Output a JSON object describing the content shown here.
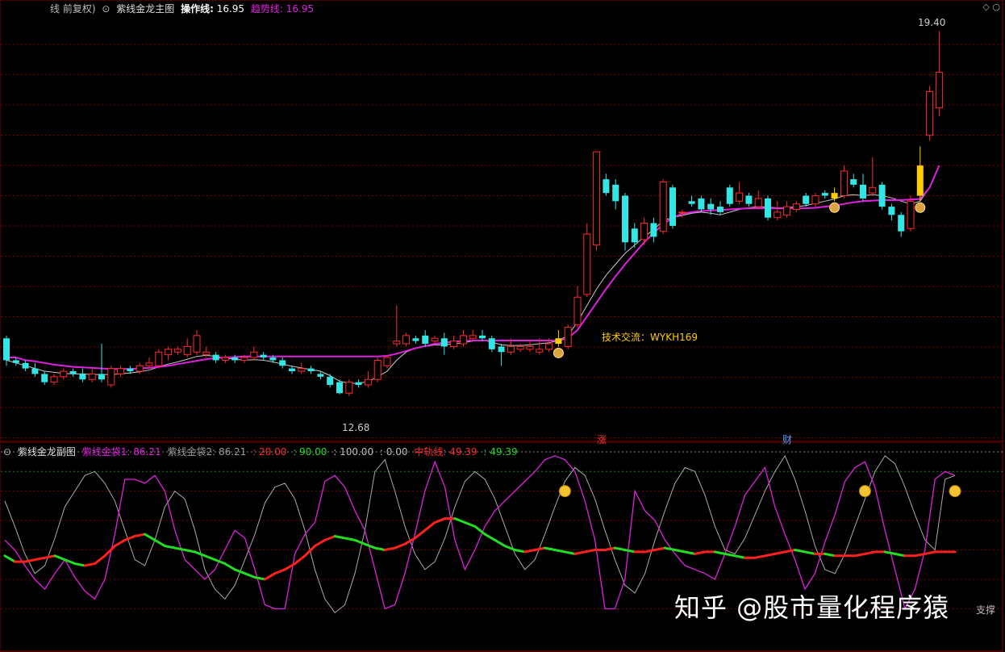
{
  "colors": {
    "bg": "#000000",
    "up": "#ff2a2a",
    "down": "#33e6e6",
    "signal": "#ffcc00",
    "trend": "#e020e0",
    "operate": "#c8c8c8",
    "grid": "#7a0000",
    "bullish_line": "#ff2020",
    "bearish_line": "#22dd22",
    "gold_bag1": "#e020e0",
    "gold_bag2": "#aaaaaa"
  },
  "header_main": {
    "mode_text": "线 前复权)",
    "chart_name": "紫线金龙主图",
    "operate_label": "操作线:",
    "operate_value": "16.95",
    "trend_label": "趋势线:",
    "trend_value": "16.95"
  },
  "header_ind": {
    "name": "紫线金龙副图",
    "bag1_label": "紫线金袋1:",
    "bag1_value": "86.21",
    "bag2_label": "紫线金袋2:",
    "bag2_value": "86.21",
    "level1": ": 20.00",
    "level2": ": 90.00",
    "level3": ": 100.00",
    "level4": ": 0.00",
    "mid_label": "中轨线:",
    "mid_value": "49.39",
    "mid_value2": ": 49.39"
  },
  "annotations": {
    "high_label": "19.40",
    "low_label": "12.68",
    "tech_note": "技术交流：WYKH169",
    "event_zhang": "涨",
    "event_cai": "财",
    "side_text": "支撑"
  },
  "watermark": "知乎 @股市量化程序猿",
  "chart_data": [
    {
      "type": "candlestick",
      "title": "紫线金龙主图",
      "ylim": [
        12.2,
        19.6
      ],
      "candles": [
        [
          13.8,
          13.4,
          13.85,
          13.3
        ],
        [
          13.4,
          13.35,
          13.45,
          13.3
        ],
        [
          13.35,
          13.25,
          13.4,
          13.2
        ],
        [
          13.25,
          13.15,
          13.35,
          13.1
        ],
        [
          13.15,
          13.0,
          13.2,
          12.95
        ],
        [
          13.0,
          13.1,
          13.15,
          12.95
        ],
        [
          13.1,
          13.2,
          13.25,
          13.05
        ],
        [
          13.2,
          13.15,
          13.25,
          13.1
        ],
        [
          13.15,
          13.05,
          13.25,
          13.0
        ],
        [
          13.05,
          13.15,
          13.25,
          13.0
        ],
        [
          13.15,
          13.05,
          13.7,
          13.0
        ],
        [
          12.95,
          13.25,
          13.3,
          12.9
        ],
        [
          13.15,
          13.25,
          13.3,
          13.1
        ],
        [
          13.25,
          13.2,
          13.3,
          13.15
        ],
        [
          13.2,
          13.3,
          13.35,
          13.15
        ],
        [
          13.3,
          13.35,
          13.45,
          13.25
        ],
        [
          13.3,
          13.55,
          13.6,
          13.25
        ],
        [
          13.5,
          13.6,
          13.65,
          13.4
        ],
        [
          13.55,
          13.6,
          13.65,
          13.5
        ],
        [
          13.5,
          13.65,
          13.8,
          13.45
        ],
        [
          13.55,
          13.85,
          13.95,
          13.5
        ],
        [
          13.5,
          13.55,
          13.65,
          13.45
        ],
        [
          13.5,
          13.4,
          13.55,
          13.35
        ],
        [
          13.4,
          13.45,
          13.5,
          13.35
        ],
        [
          13.45,
          13.4,
          13.5,
          13.35
        ],
        [
          13.4,
          13.45,
          13.5,
          13.35
        ],
        [
          13.45,
          13.55,
          13.65,
          13.4
        ],
        [
          13.5,
          13.45,
          13.55,
          13.4
        ],
        [
          13.45,
          13.4,
          13.5,
          13.35
        ],
        [
          13.4,
          13.3,
          13.45,
          13.25
        ],
        [
          13.25,
          13.2,
          13.3,
          13.15
        ],
        [
          13.2,
          13.25,
          13.35,
          13.15
        ],
        [
          13.25,
          13.2,
          13.3,
          13.15
        ],
        [
          13.15,
          13.1,
          13.2,
          13.05
        ],
        [
          13.1,
          12.95,
          13.15,
          12.9
        ],
        [
          13.0,
          12.8,
          13.05,
          12.78
        ],
        [
          12.8,
          13.0,
          13.05,
          12.75
        ],
        [
          13.0,
          12.95,
          13.05,
          12.9
        ],
        [
          12.95,
          13.05,
          13.2,
          12.9
        ],
        [
          13.05,
          13.4,
          13.45,
          13.0
        ],
        [
          13.3,
          13.45,
          13.5,
          13.25
        ],
        [
          13.7,
          13.75,
          14.4,
          13.65
        ],
        [
          13.7,
          13.85,
          13.9,
          13.65
        ],
        [
          13.8,
          13.75,
          13.85,
          13.7
        ],
        [
          13.85,
          13.7,
          13.95,
          13.65
        ],
        [
          13.75,
          13.8,
          13.85,
          13.7
        ],
        [
          13.8,
          13.65,
          13.9,
          13.5
        ],
        [
          13.65,
          13.75,
          13.85,
          13.6
        ],
        [
          13.7,
          13.85,
          13.95,
          13.65
        ],
        [
          13.8,
          13.85,
          13.95,
          13.75
        ],
        [
          13.85,
          13.8,
          13.95,
          13.75
        ],
        [
          13.8,
          13.6,
          13.85,
          13.55
        ],
        [
          13.65,
          13.55,
          13.7,
          13.3
        ],
        [
          13.55,
          13.65,
          13.8,
          13.5
        ],
        [
          13.6,
          13.65,
          13.7,
          13.55
        ],
        [
          13.6,
          13.65,
          13.75,
          13.55
        ],
        [
          13.55,
          13.6,
          13.8,
          13.5
        ],
        [
          13.6,
          13.7,
          13.8,
          13.55
        ],
        [
          13.7,
          13.8,
          13.95,
          13.65
        ],
        [
          13.65,
          14.0,
          14.05,
          13.6
        ],
        [
          14.05,
          14.55,
          14.75,
          14.0
        ],
        [
          14.6,
          15.7,
          15.9,
          14.55
        ],
        [
          15.5,
          17.2,
          17.2,
          15.4
        ],
        [
          16.7,
          16.45,
          16.8,
          16.4
        ],
        [
          16.6,
          16.3,
          16.7,
          16.15
        ],
        [
          16.4,
          15.55,
          16.45,
          15.4
        ],
        [
          15.8,
          15.55,
          15.9,
          15.45
        ],
        [
          15.6,
          15.9,
          16.0,
          15.5
        ],
        [
          15.9,
          15.65,
          16.0,
          15.55
        ],
        [
          15.75,
          16.65,
          16.7,
          15.7
        ],
        [
          16.55,
          15.85,
          16.6,
          15.8
        ],
        [
          16.1,
          16.1,
          16.15,
          16.0
        ],
        [
          16.3,
          16.25,
          16.4,
          16.2
        ],
        [
          16.35,
          16.15,
          16.4,
          16.1
        ],
        [
          16.25,
          16.15,
          16.35,
          16.05
        ],
        [
          16.2,
          16.1,
          16.3,
          16.05
        ],
        [
          16.55,
          16.25,
          16.6,
          16.2
        ],
        [
          16.3,
          16.45,
          16.65,
          16.25
        ],
        [
          16.4,
          16.25,
          16.45,
          16.2
        ],
        [
          16.2,
          16.35,
          16.5,
          16.15
        ],
        [
          16.35,
          16.0,
          16.4,
          15.95
        ],
        [
          16.0,
          16.1,
          16.3,
          15.95
        ],
        [
          16.05,
          16.2,
          16.3,
          16.0
        ],
        [
          16.15,
          16.25,
          16.3,
          16.1
        ],
        [
          16.4,
          16.25,
          16.45,
          16.2
        ],
        [
          16.25,
          16.4,
          16.45,
          16.2
        ],
        [
          16.45,
          16.4,
          16.5,
          16.35
        ],
        [
          16.35,
          16.45,
          16.55,
          16.3
        ],
        [
          16.4,
          16.85,
          16.95,
          16.35
        ],
        [
          16.7,
          16.6,
          16.8,
          16.55
        ],
        [
          16.6,
          16.35,
          16.8,
          16.3
        ],
        [
          16.45,
          16.55,
          17.1,
          16.4
        ],
        [
          16.6,
          16.2,
          16.65,
          16.15
        ],
        [
          16.2,
          16.05,
          16.25,
          15.95
        ],
        [
          16.05,
          15.75,
          16.1,
          15.65
        ],
        [
          15.8,
          16.3,
          16.4,
          15.75
        ],
        [
          16.4,
          16.95,
          17.3,
          16.3
        ],
        [
          17.5,
          18.3,
          18.4,
          17.4
        ],
        [
          18.0,
          18.65,
          19.4,
          17.85
        ]
      ],
      "signal_bars": [
        58,
        87,
        96
      ],
      "trend_line": [
        13.45,
        13.45,
        13.4,
        13.38,
        13.35,
        13.32,
        13.3,
        13.28,
        13.27,
        13.26,
        13.25,
        13.24,
        13.24,
        13.24,
        13.25,
        13.26,
        13.28,
        13.3,
        13.33,
        13.36,
        13.39,
        13.42,
        13.44,
        13.45,
        13.46,
        13.47,
        13.47,
        13.47,
        13.47,
        13.47,
        13.47,
        13.47,
        13.47,
        13.47,
        13.47,
        13.47,
        13.47,
        13.47,
        13.47,
        13.47,
        13.48,
        13.52,
        13.57,
        13.62,
        13.66,
        13.7,
        13.72,
        13.74,
        13.75,
        13.76,
        13.76,
        13.76,
        13.76,
        13.76,
        13.76,
        13.76,
        13.76,
        13.76,
        13.76,
        13.8,
        13.95,
        14.2,
        14.45,
        14.7,
        14.93,
        15.15,
        15.35,
        15.55,
        15.72,
        15.88,
        16.0,
        16.07,
        16.1,
        16.12,
        16.13,
        16.14,
        16.15,
        16.16,
        16.17,
        16.17,
        16.17,
        16.17,
        16.17,
        16.17,
        16.17,
        16.18,
        16.2,
        16.22,
        16.25,
        16.28,
        16.3,
        16.31,
        16.32,
        16.32,
        16.32,
        16.33,
        16.34,
        16.55,
        16.95
      ],
      "operate_line": [
        13.4,
        13.35,
        13.3,
        13.25,
        13.2,
        13.18,
        13.16,
        13.15,
        13.15,
        13.14,
        13.14,
        13.14,
        13.15,
        13.17,
        13.19,
        13.22,
        13.28,
        13.33,
        13.37,
        13.42,
        13.47,
        13.49,
        13.47,
        13.44,
        13.42,
        13.4,
        13.41,
        13.4,
        13.37,
        13.33,
        13.29,
        13.26,
        13.23,
        13.2,
        13.12,
        13.02,
        12.98,
        12.98,
        13.01,
        13.1,
        13.2,
        13.4,
        13.55,
        13.62,
        13.65,
        13.68,
        13.68,
        13.7,
        13.72,
        13.75,
        13.77,
        13.73,
        13.68,
        13.67,
        13.67,
        13.68,
        13.7,
        13.72,
        13.76,
        13.85,
        14.1,
        14.4,
        14.7,
        14.95,
        15.15,
        15.35,
        15.5,
        15.65,
        15.78,
        15.95,
        16.0,
        16.04,
        16.08,
        16.1,
        16.08,
        16.05,
        16.1,
        16.15,
        16.18,
        16.2,
        16.19,
        16.18,
        16.18,
        16.2,
        16.22,
        16.26,
        16.3,
        16.34,
        16.4,
        16.42,
        16.4,
        16.42,
        16.4,
        16.36,
        16.3,
        16.25,
        16.3,
        16.55,
        16.95
      ]
    },
    {
      "type": "line",
      "title": "紫线金龙副图",
      "ylim": [
        0,
        100
      ],
      "levels": [
        100,
        90,
        80,
        65,
        50,
        35,
        20
      ],
      "series": [
        {
          "name": "紫线金袋1",
          "values": [
            55,
            50,
            42,
            35,
            30,
            38,
            45,
            36,
            29,
            25,
            35,
            58,
            86,
            86,
            84,
            88,
            80,
            60,
            45,
            40,
            35,
            40,
            50,
            60,
            56,
            40,
            22,
            20,
            20,
            48,
            58,
            64,
            85,
            88,
            82,
            70,
            60,
            40,
            20,
            22,
            38,
            58,
            80,
            95,
            82,
            55,
            40,
            50,
            62,
            70,
            75,
            80,
            85,
            90,
            96,
            98,
            96,
            90,
            75,
            55,
            20,
            20,
            35,
            80,
            70,
            65,
            55,
            48,
            42,
            40,
            38,
            35,
            48,
            62,
            78,
            85,
            92,
            72,
            58,
            45,
            30,
            38,
            54,
            68,
            85,
            92,
            95,
            82,
            60,
            40,
            20,
            30,
            50,
            86,
            90,
            88
          ]
        },
        {
          "name": "紫线金袋2",
          "values": [
            75,
            62,
            48,
            38,
            42,
            56,
            72,
            80,
            88,
            90,
            84,
            75,
            60,
            45,
            42,
            55,
            72,
            80,
            76,
            60,
            40,
            30,
            25,
            32,
            45,
            58,
            74,
            82,
            84,
            76,
            60,
            40,
            25,
            18,
            22,
            38,
            60,
            90,
            96,
            80,
            62,
            48,
            40,
            44,
            56,
            72,
            85,
            90,
            86,
            76,
            62,
            48,
            40,
            45,
            58,
            72,
            85,
            92,
            88,
            76,
            60,
            45,
            32,
            28,
            38,
            55,
            70,
            84,
            92,
            90,
            78,
            62,
            50,
            48,
            56,
            68,
            80,
            90,
            98,
            86,
            70,
            52,
            40,
            38,
            48,
            62,
            76,
            90,
            98,
            94,
            82,
            68,
            55,
            50,
            86,
            88
          ]
        },
        {
          "name": "中轨线",
          "values": [
            47,
            44,
            44,
            45,
            46,
            47,
            45,
            43,
            42,
            43,
            47,
            52,
            55,
            57,
            58,
            55,
            52,
            51,
            50,
            49,
            47,
            45,
            43,
            40,
            38,
            36,
            35,
            38,
            40,
            43,
            47,
            52,
            55,
            57,
            56,
            55,
            53,
            51,
            50,
            51,
            53,
            56,
            60,
            64,
            66,
            66,
            64,
            62,
            58,
            55,
            52,
            50,
            49,
            50,
            51,
            50,
            49,
            48,
            49,
            50,
            50,
            51,
            50,
            49,
            49,
            50,
            51,
            50,
            49,
            48,
            49,
            49,
            48,
            47,
            46,
            46,
            47,
            48,
            49,
            50,
            49,
            48,
            48,
            47,
            47,
            47,
            48,
            49,
            49,
            48,
            47,
            47,
            48,
            49,
            49,
            49
          ]
        }
      ]
    }
  ]
}
